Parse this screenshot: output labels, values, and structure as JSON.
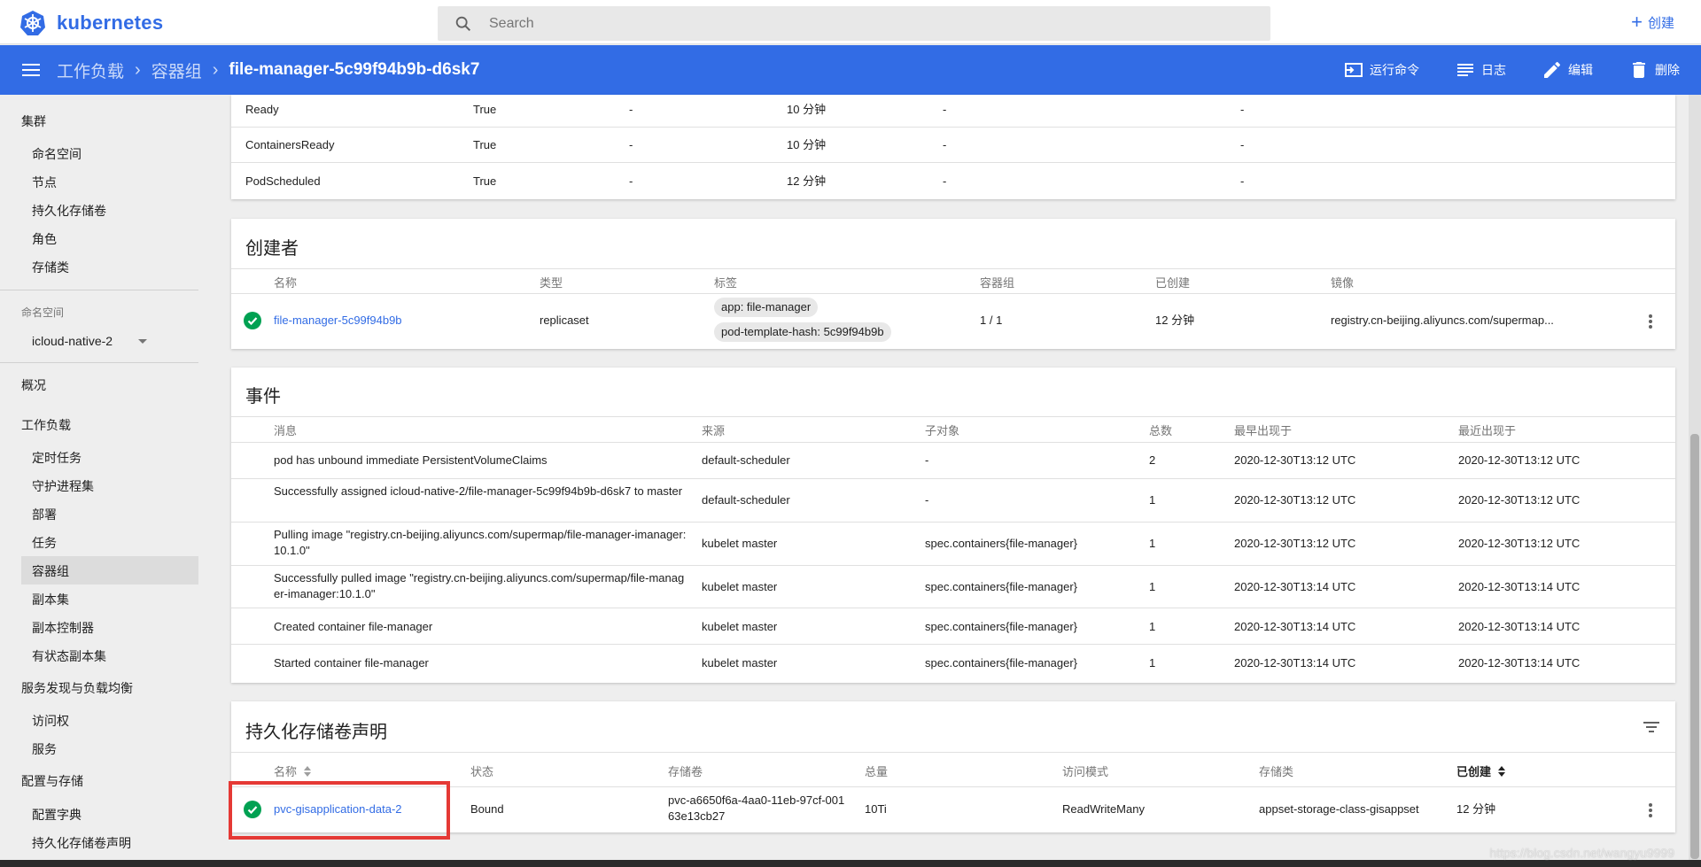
{
  "app": {
    "name": "kubernetes",
    "brand_color": "#326ce5"
  },
  "search": {
    "placeholder": "Search"
  },
  "topbar": {
    "create_label": "创建"
  },
  "breadcrumb": {
    "items": [
      "工作负载",
      "容器组"
    ],
    "current": "file-manager-5c99f94b9b-d6sk7"
  },
  "actions": {
    "exec": "运行命令",
    "logs": "日志",
    "edit": "编辑",
    "delete": "删除"
  },
  "sidebar": {
    "cluster": {
      "title": "集群",
      "items": [
        "命名空间",
        "节点",
        "持久化存储卷",
        "角色",
        "存储类"
      ]
    },
    "namespace": {
      "label": "命名空间",
      "value": "icloud-native-2"
    },
    "overview": "概况",
    "workloads": {
      "title": "工作负载",
      "items": [
        "定时任务",
        "守护进程集",
        "部署",
        "任务",
        "容器组",
        "副本集",
        "副本控制器",
        "有状态副本集"
      ],
      "active": "容器组"
    },
    "discovery": {
      "title": "服务发现与负载均衡",
      "items": [
        "访问权",
        "服务"
      ]
    },
    "config": {
      "title": "配置与存储",
      "items": [
        "配置字典",
        "持久化存储卷声明"
      ]
    }
  },
  "conditions": {
    "rows": [
      {
        "type": "Ready",
        "status": "True",
        "probe": "-",
        "transition": "10 分钟",
        "reason": "-",
        "message": "-"
      },
      {
        "type": "ContainersReady",
        "status": "True",
        "probe": "-",
        "transition": "10 分钟",
        "reason": "-",
        "message": "-"
      },
      {
        "type": "PodScheduled",
        "status": "True",
        "probe": "-",
        "transition": "12 分钟",
        "reason": "-",
        "message": "-"
      }
    ]
  },
  "creator": {
    "title": "创建者",
    "headers": {
      "name": "名称",
      "kind": "类型",
      "labels": "标签",
      "pods": "容器组",
      "created": "已创建",
      "image": "镜像"
    },
    "row": {
      "name": "file-manager-5c99f94b9b",
      "kind": "replicaset",
      "labels": [
        "app: file-manager",
        "pod-template-hash: 5c99f94b9b"
      ],
      "pods": "1 / 1",
      "created": "12 分钟",
      "image": "registry.cn-beijing.aliyuncs.com/supermap..."
    }
  },
  "events": {
    "title": "事件",
    "headers": {
      "message": "消息",
      "source": "来源",
      "subobject": "子对象",
      "count": "总数",
      "first": "最早出现于",
      "last": "最近出现于"
    },
    "rows": [
      {
        "message": "pod has unbound immediate PersistentVolumeClaims",
        "source": "default-scheduler",
        "subobject": "-",
        "count": "2",
        "first": "2020-12-30T13:12 UTC",
        "last": "2020-12-30T13:12 UTC"
      },
      {
        "message": "Successfully assigned icloud-native-2/file-manager-5c99f94b9b-d6sk7 to master",
        "source": "default-scheduler",
        "subobject": "-",
        "count": "1",
        "first": "2020-12-30T13:12 UTC",
        "last": "2020-12-30T13:12 UTC"
      },
      {
        "message": "Pulling image \"registry.cn-beijing.aliyuncs.com/supermap/file-manager-imanager:10.1.0\"",
        "source": "kubelet master",
        "subobject": "spec.containers{file-manager}",
        "count": "1",
        "first": "2020-12-30T13:12 UTC",
        "last": "2020-12-30T13:12 UTC"
      },
      {
        "message": "Successfully pulled image \"registry.cn-beijing.aliyuncs.com/supermap/file-manager-imanager:10.1.0\"",
        "source": "kubelet master",
        "subobject": "spec.containers{file-manager}",
        "count": "1",
        "first": "2020-12-30T13:14 UTC",
        "last": "2020-12-30T13:14 UTC"
      },
      {
        "message": "Created container file-manager",
        "source": "kubelet master",
        "subobject": "spec.containers{file-manager}",
        "count": "1",
        "first": "2020-12-30T13:14 UTC",
        "last": "2020-12-30T13:14 UTC"
      },
      {
        "message": "Started container file-manager",
        "source": "kubelet master",
        "subobject": "spec.containers{file-manager}",
        "count": "1",
        "first": "2020-12-30T13:14 UTC",
        "last": "2020-12-30T13:14 UTC"
      }
    ]
  },
  "pvc": {
    "title": "持久化存储卷声明",
    "headers": {
      "name": "名称",
      "status": "状态",
      "volume": "存储卷",
      "capacity": "总量",
      "access": "访问模式",
      "storageclass": "存储类",
      "created": "已创建"
    },
    "row": {
      "name": "pvc-gisapplication-data-2",
      "status": "Bound",
      "volume": "pvc-a6650f6a-4aa0-11eb-97cf-00163e13cb27",
      "capacity": "10Ti",
      "access": "ReadWriteMany",
      "storageclass": "appset-storage-class-gisappset",
      "created": "12 分钟"
    }
  },
  "watermark": "https://blog.csdn.net/wangyu9999"
}
